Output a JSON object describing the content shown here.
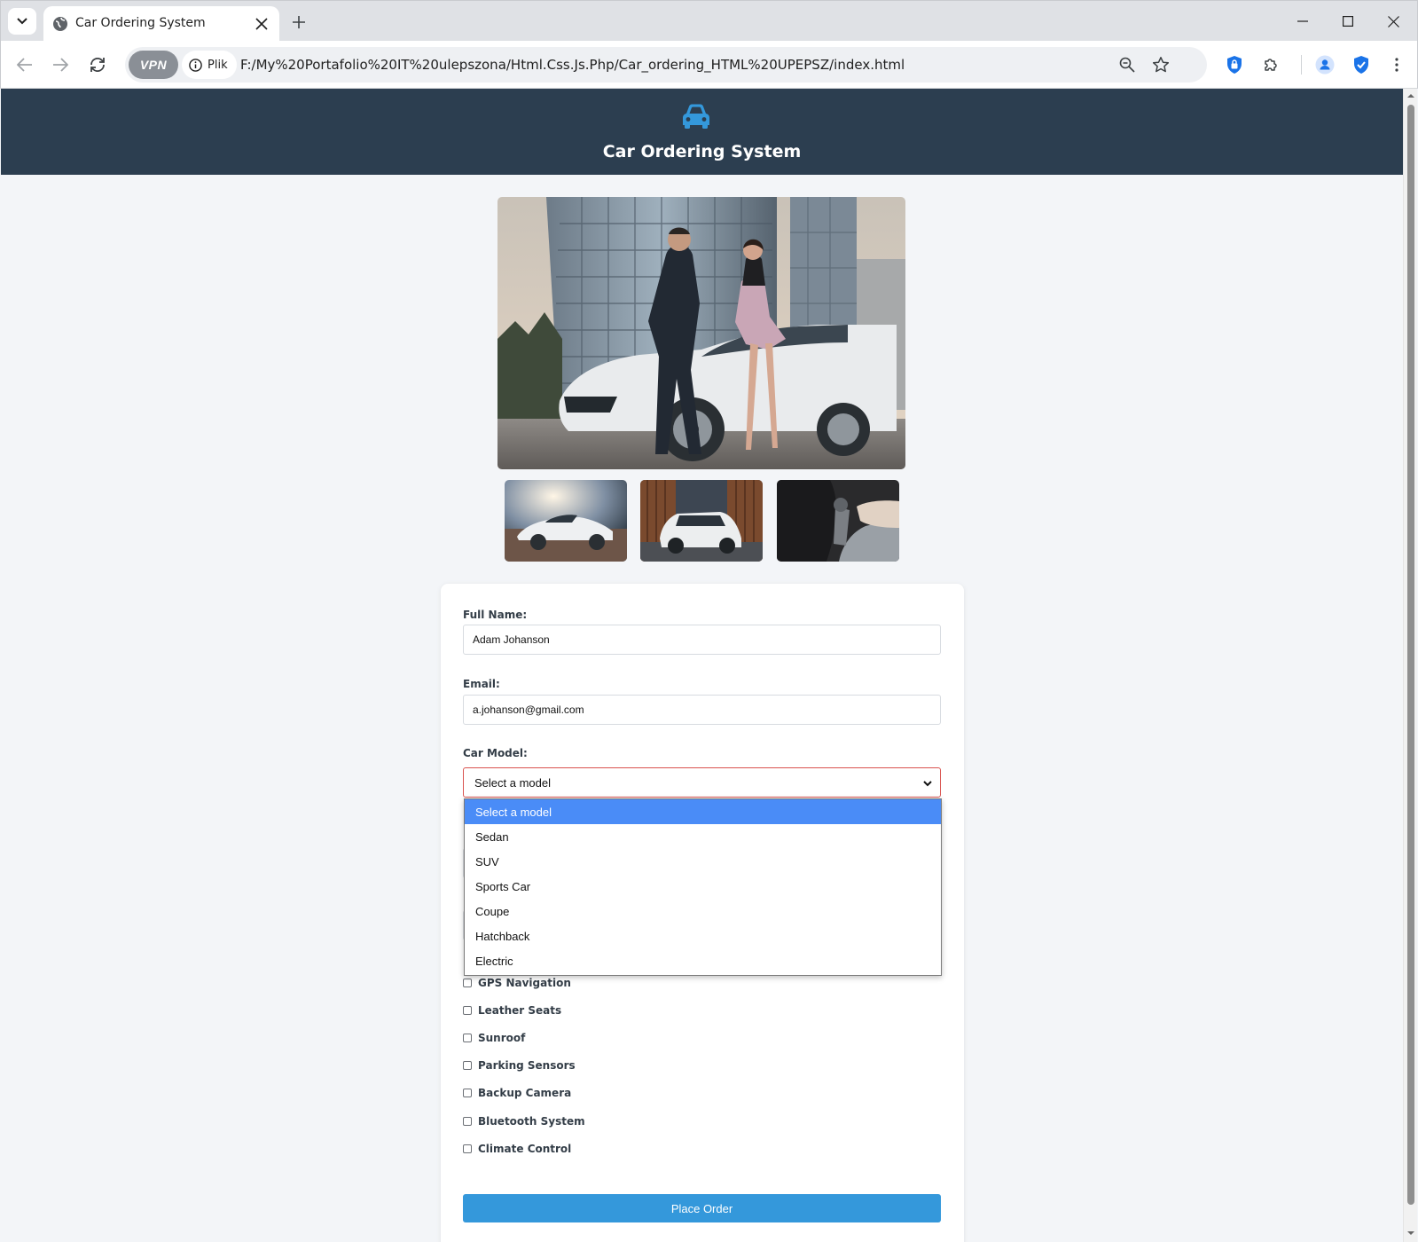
{
  "browser": {
    "tab_title": "Car Ordering System",
    "new_tab": "+",
    "site_chip": "Plik",
    "vpn_label": "VPN",
    "url": "F:/My%20Portafolio%20IT%20ulepszona/Html.Css.Js.Php/Car_ordering_HTML%20UPEPSZ/index.html"
  },
  "header": {
    "title": "Car Ordering System",
    "logo_icon": "car-icon",
    "colors": {
      "background": "#2c3e50",
      "logo": "#3498db"
    }
  },
  "gallery": {
    "hero": "couple-with-white-car-photo",
    "thumbnails": [
      "white-sports-car-photo",
      "white-suv-photo",
      "gear-shift-photo"
    ]
  },
  "form": {
    "full_name": {
      "label": "Full Name:",
      "value": "Adam Johanson"
    },
    "email": {
      "label": "Email:",
      "value": "a.johanson@gmail.com"
    },
    "car_model": {
      "label": "Car Model:",
      "selected": "Select a model",
      "options": [
        "Select a model",
        "Sedan",
        "SUV",
        "Sports Car",
        "Coupe",
        "Hatchback",
        "Electric"
      ]
    },
    "features": [
      "GPS Navigation",
      "Leather Seats",
      "Sunroof",
      "Parking Sensors",
      "Backup Camera",
      "Bluetooth System",
      "Climate Control"
    ],
    "submit_label": "Place Order",
    "colors": {
      "accent": "#3498db",
      "invalid_border": "#d9534f",
      "option_highlight": "#4a8cf7"
    }
  }
}
